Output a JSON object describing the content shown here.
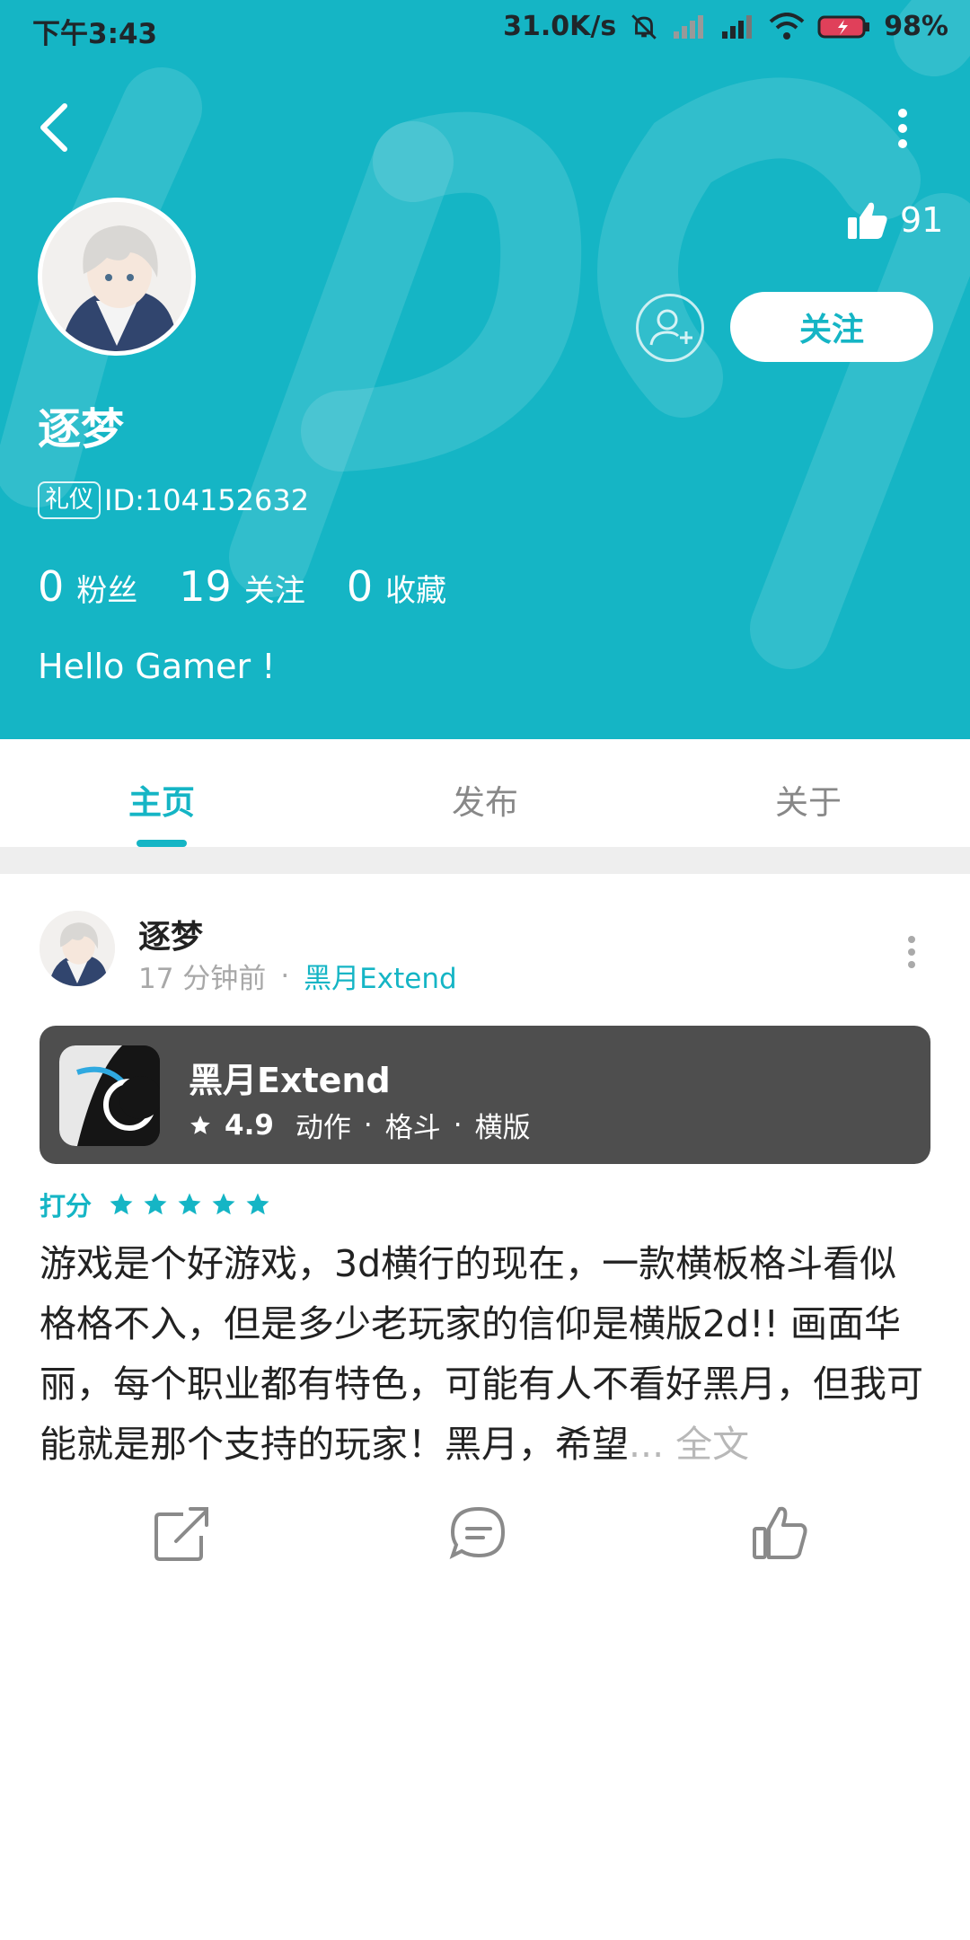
{
  "status_bar": {
    "time": "下午3:43",
    "net_speed": "31.0K/s",
    "battery": "98%"
  },
  "profile": {
    "likes": "91",
    "name": "逐梦",
    "badge": "礼仪",
    "id_text": "ID:104152632",
    "stats": [
      {
        "num": "0",
        "label": "粉丝"
      },
      {
        "num": "19",
        "label": "关注"
      },
      {
        "num": "0",
        "label": "收藏"
      }
    ],
    "bio": "Hello Gamer !",
    "follow_label": "关注"
  },
  "tabs": [
    {
      "label": "主页",
      "active": true
    },
    {
      "label": "发布",
      "active": false
    },
    {
      "label": "关于",
      "active": false
    }
  ],
  "post": {
    "user": "逐梦",
    "time": "17 分钟前",
    "dot": "·",
    "game": "黑月Extend",
    "card": {
      "title": "黑月Extend",
      "score": "4.9",
      "tags": [
        "动作",
        "格斗",
        "横版"
      ],
      "sep": "·"
    },
    "rating_label": "打分",
    "rating_stars": 5,
    "text": "游戏是个好游戏，3d横行的现在，一款横板格斗看似格格不入，但是多少老玩家的信仰是横版2d!! 画面华丽，每个职业都有特色，可能有人不看好黑月，但我可能就是那个支持的玩家！黑月，希望",
    "ellipsis": "...",
    "full_text_link": "全文"
  },
  "colors": {
    "accent": "#15b5c5",
    "card_bg": "#4e4e4e",
    "separator": "#eeeeee"
  },
  "icons": [
    "back-arrow-icon",
    "more-vertical-icon",
    "thumbs-up-icon",
    "add-friend-icon",
    "star-icon",
    "share-icon",
    "comment-icon",
    "like-icon"
  ]
}
